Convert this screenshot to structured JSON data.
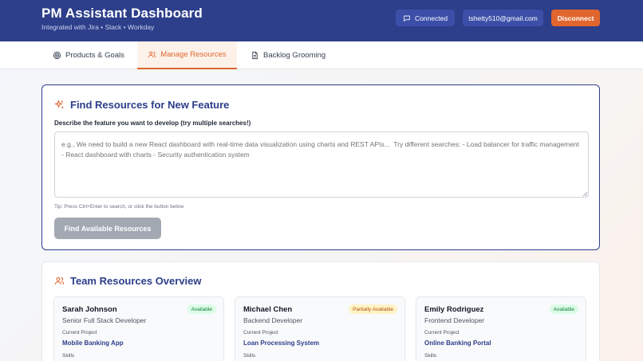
{
  "header": {
    "title": "PM Assistant Dashboard",
    "subtitle": "Integrated with Jira • Slack • Workday",
    "connected_label": "Connected",
    "email": "tshetty510@gmail.com",
    "disconnect_label": "Disconnect"
  },
  "tabs": [
    {
      "label": "Products & Goals",
      "icon": "target-icon",
      "active": false
    },
    {
      "label": "Manage Resources",
      "icon": "users-icon",
      "active": true
    },
    {
      "label": "Backlog Grooming",
      "icon": "document-icon",
      "active": false
    }
  ],
  "find": {
    "title": "Find Resources for New Feature",
    "field_label": "Describe the feature you want to develop (try multiple searches!)",
    "placeholder": "e.g., We need to build a new React dashboard with real-time data visualization using charts and REST APIs...  Try different searches: - Load balancer for traffic management - React dashboard with charts - Security authentication system",
    "tip": "Tip: Press Ctrl+Enter to search, or click the button below",
    "button_label": "Find Available Resources"
  },
  "team": {
    "title": "Team Resources Overview",
    "resources": [
      {
        "name": "Sarah Johnson",
        "role": "Senior Full Stack Developer",
        "status": "Available",
        "project_label": "Current Project",
        "project": "Mobile Banking App",
        "skills_label": "Skills"
      },
      {
        "name": "Michael Chen",
        "role": "Backend Developer",
        "status": "Partially Available",
        "project_label": "Current Project",
        "project": "Loan Processing System",
        "skills_label": "Skills"
      },
      {
        "name": "Emily Rodriguez",
        "role": "Frontend Developer",
        "status": "Available",
        "project_label": "Current Project",
        "project": "Online Banking Portal",
        "skills_label": "Skills"
      }
    ]
  },
  "colors": {
    "primary": "#2d3e8a",
    "accent": "#e0662e",
    "available": "#15803d",
    "partial": "#b45309"
  }
}
